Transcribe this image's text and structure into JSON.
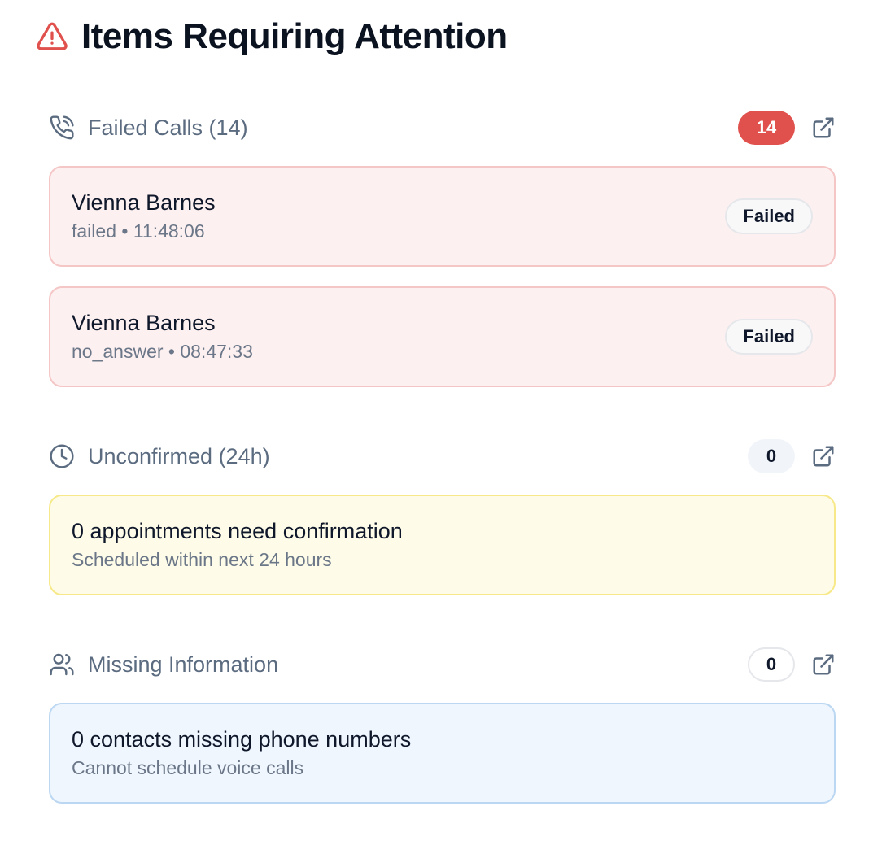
{
  "title": "Items Requiring Attention",
  "sections": {
    "failed": {
      "title": "Failed Calls (14)",
      "count": "14",
      "items": [
        {
          "name": "Vienna Barnes",
          "status": "failed",
          "time": "11:48:06",
          "badge": "Failed",
          "meta": "failed • 11:48:06"
        },
        {
          "name": "Vienna Barnes",
          "status": "no_answer",
          "time": "08:47:33",
          "badge": "Failed",
          "meta": "no_answer • 08:47:33"
        }
      ]
    },
    "unconfirmed": {
      "title": "Unconfirmed (24h)",
      "count": "0",
      "card_title": "0 appointments need confirmation",
      "card_sub": "Scheduled within next 24 hours"
    },
    "missing": {
      "title": "Missing Information",
      "count": "0",
      "card_title": "0 contacts missing phone numbers",
      "card_sub": "Cannot schedule voice calls"
    }
  },
  "colors": {
    "alert_red": "#e0504c",
    "muted_text": "#5b6b80",
    "fail_bg": "#fdf0f0",
    "warn_bg": "#fefce8",
    "info_bg": "#eff6fe"
  },
  "icons": [
    "alert-triangle-icon",
    "phone-call-icon",
    "clock-icon",
    "users-icon",
    "external-link-icon"
  ]
}
